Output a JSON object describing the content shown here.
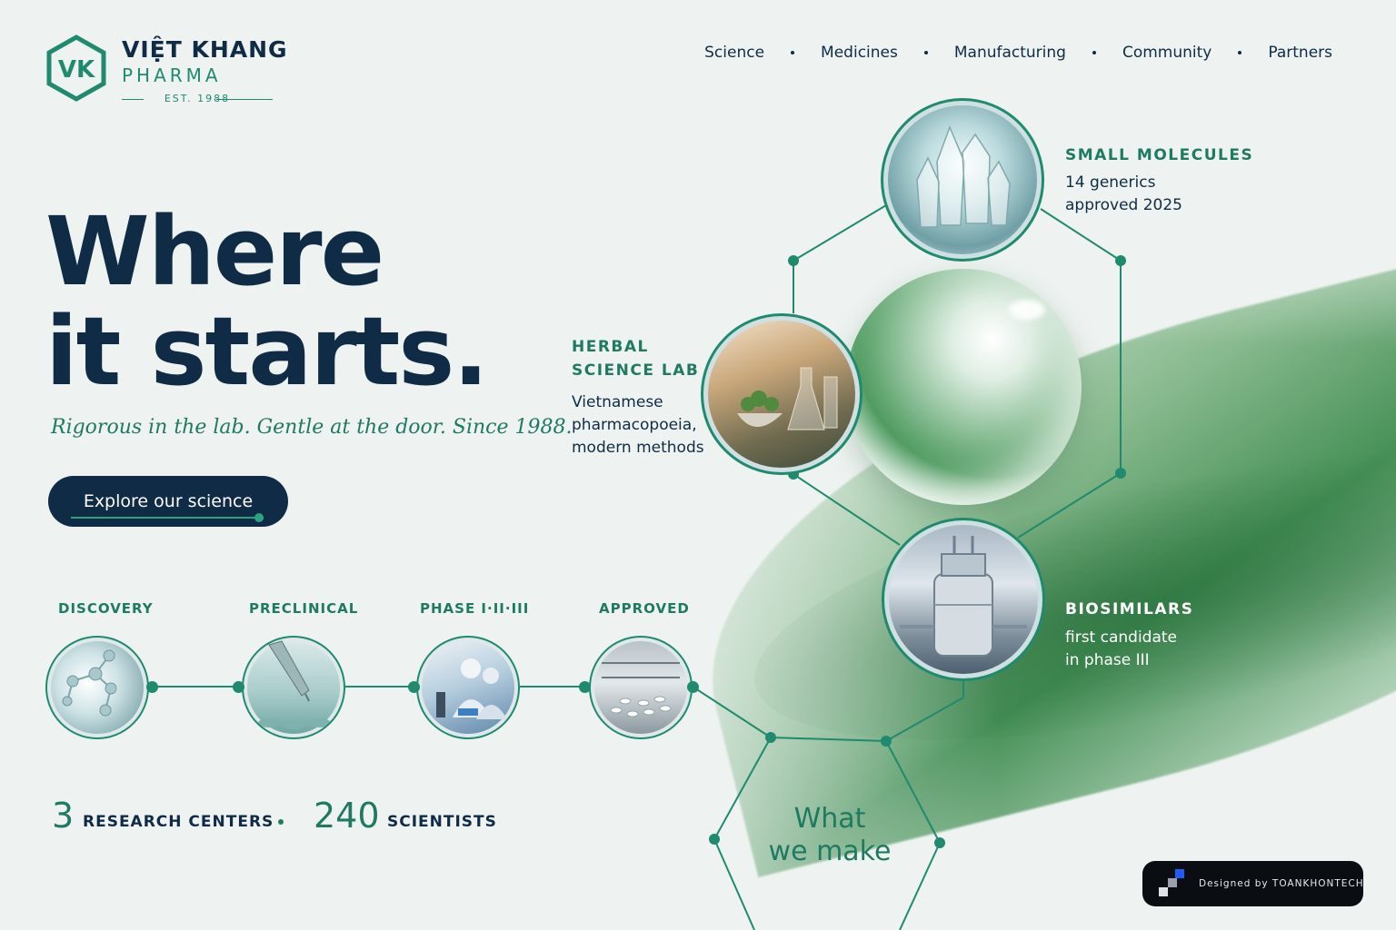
{
  "brand": {
    "name": "VIỆT KHANG",
    "sub": "PHARMA",
    "est": "EST. 1988",
    "mark": "VK"
  },
  "nav": {
    "items": [
      {
        "label": "Science"
      },
      {
        "label": "Medicines"
      },
      {
        "label": "Manufacturing"
      },
      {
        "label": "Community"
      },
      {
        "label": "Partners"
      }
    ]
  },
  "hero": {
    "line1": "Where",
    "line2": "it starts.",
    "tagline": "Rigorous in the lab. Gentle at the door. Since 1988.",
    "cta_label": "Explore our science"
  },
  "pipeline": {
    "stages": [
      {
        "label": "DISCOVERY",
        "icon": "molecule-photo"
      },
      {
        "label": "PRECLINICAL",
        "icon": "pipette-photo"
      },
      {
        "label": "PHASE I·II·III",
        "icon": "lab-scientists-photo"
      },
      {
        "label": "APPROVED",
        "icon": "pill-production-photo"
      }
    ]
  },
  "stats": {
    "research_num": "3",
    "research_label": "RESEARCH CENTERS",
    "scientists_num": "240",
    "scientists_label": "SCIENTISTS"
  },
  "products": {
    "small_molecules": {
      "title": "SMALL MOLECULES",
      "line1": "14 generics",
      "line2": "approved 2025"
    },
    "herbal": {
      "title1": "HERBAL",
      "title2": "SCIENCE LAB",
      "line1": "Vietnamese",
      "line2": "pharmacopoeia,",
      "line3": "modern methods"
    },
    "biosimilars": {
      "title": "BIOSIMILARS",
      "line1": "first candidate",
      "line2": "in phase III"
    }
  },
  "hexagon": {
    "line1": "What",
    "line2": "we make"
  },
  "badge": {
    "text": "Designed by TOANKHONTECH"
  },
  "colors": {
    "navy": "#0f2b45",
    "teal": "#1f8a6e",
    "background": "#eef3f1"
  }
}
